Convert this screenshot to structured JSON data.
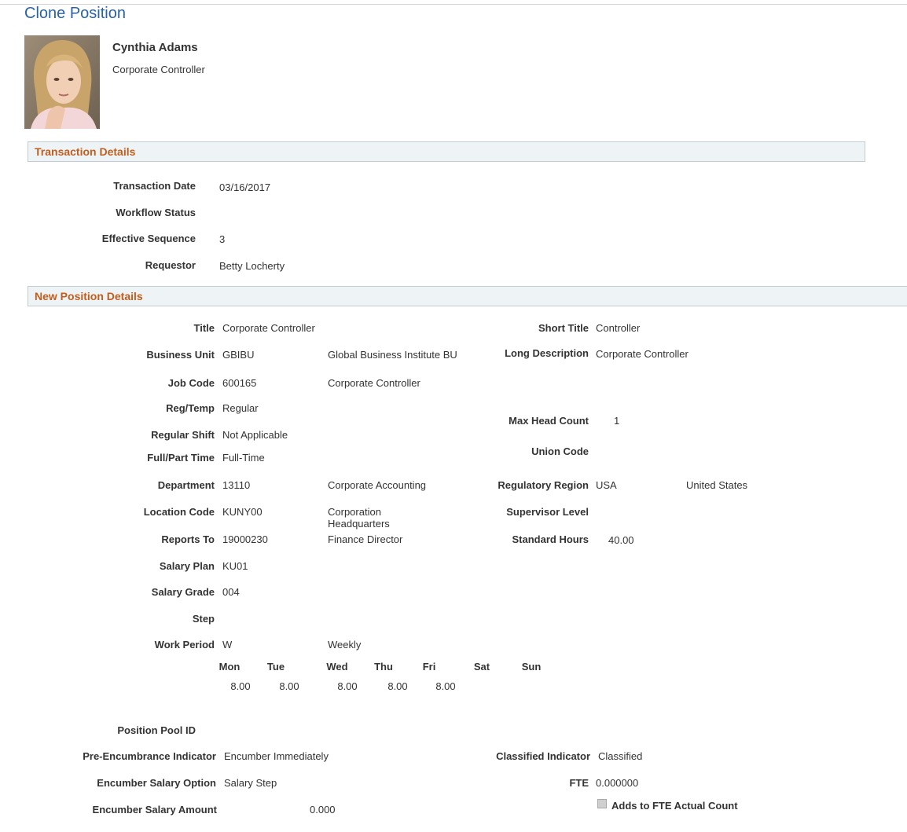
{
  "page": {
    "title": "Clone Position"
  },
  "employee": {
    "name": "Cynthia Adams",
    "job_title": "Corporate Controller"
  },
  "transaction_details": {
    "header": "Transaction Details",
    "transaction_date_label": "Transaction Date",
    "transaction_date": "03/16/2017",
    "workflow_status_label": "Workflow Status",
    "workflow_status": "",
    "effective_sequence_label": "Effective Sequence",
    "effective_sequence": "3",
    "requestor_label": "Requestor",
    "requestor": "Betty Locherty"
  },
  "new_position": {
    "header": "New Position Details",
    "title_label": "Title",
    "title": "Corporate Controller",
    "short_title_label": "Short Title",
    "short_title": "Controller",
    "business_unit_label": "Business Unit",
    "business_unit": "GBIBU",
    "business_unit_desc": "Global Business Institute BU",
    "long_description_label": "Long Description",
    "long_description": "Corporate Controller",
    "job_code_label": "Job Code",
    "job_code": "600165",
    "job_code_desc": "Corporate Controller",
    "reg_temp_label": "Reg/Temp",
    "reg_temp": "Regular",
    "max_head_count_label": "Max Head Count",
    "max_head_count": "1",
    "regular_shift_label": "Regular Shift",
    "regular_shift": "Not Applicable",
    "full_part_time_label": "Full/Part Time",
    "full_part_time": "Full-Time",
    "union_code_label": "Union Code",
    "union_code": "",
    "department_label": "Department",
    "department": "13110",
    "department_desc": "Corporate Accounting",
    "regulatory_region_label": "Regulatory Region",
    "regulatory_region": "USA",
    "regulatory_region_desc": "United States",
    "location_code_label": "Location Code",
    "location_code": "KUNY00",
    "location_code_desc": "Corporation Headquarters",
    "supervisor_level_label": "Supervisor Level",
    "supervisor_level": "",
    "reports_to_label": "Reports To",
    "reports_to": "19000230",
    "reports_to_desc": "Finance Director",
    "standard_hours_label": "Standard Hours",
    "standard_hours": "40.00",
    "salary_plan_label": "Salary Plan",
    "salary_plan": "KU01",
    "salary_grade_label": "Salary Grade",
    "salary_grade": "004",
    "step_label": "Step",
    "step": "",
    "work_period_label": "Work Period",
    "work_period": "W",
    "work_period_desc": "Weekly",
    "days": [
      {
        "label": "Mon",
        "hours": "8.00"
      },
      {
        "label": "Tue",
        "hours": "8.00"
      },
      {
        "label": "Wed",
        "hours": "8.00"
      },
      {
        "label": "Thu",
        "hours": "8.00"
      },
      {
        "label": "Fri",
        "hours": "8.00"
      },
      {
        "label": "Sat",
        "hours": ""
      },
      {
        "label": "Sun",
        "hours": ""
      }
    ],
    "position_pool_id_label": "Position Pool ID",
    "position_pool_id": "",
    "pre_encumbrance_label": "Pre-Encumbrance Indicator",
    "pre_encumbrance": "Encumber Immediately",
    "classified_indicator_label": "Classified Indicator",
    "classified_indicator": "Classified",
    "encumber_salary_option_label": "Encumber Salary Option",
    "encumber_salary_option": "Salary Step",
    "fte_label": "FTE",
    "fte": "0.000000",
    "encumber_salary_amount_label": "Encumber Salary Amount",
    "encumber_salary_amount": "0.000",
    "adds_to_fte_label": "Adds to FTE Actual Count",
    "adds_to_fte_checked": true
  }
}
